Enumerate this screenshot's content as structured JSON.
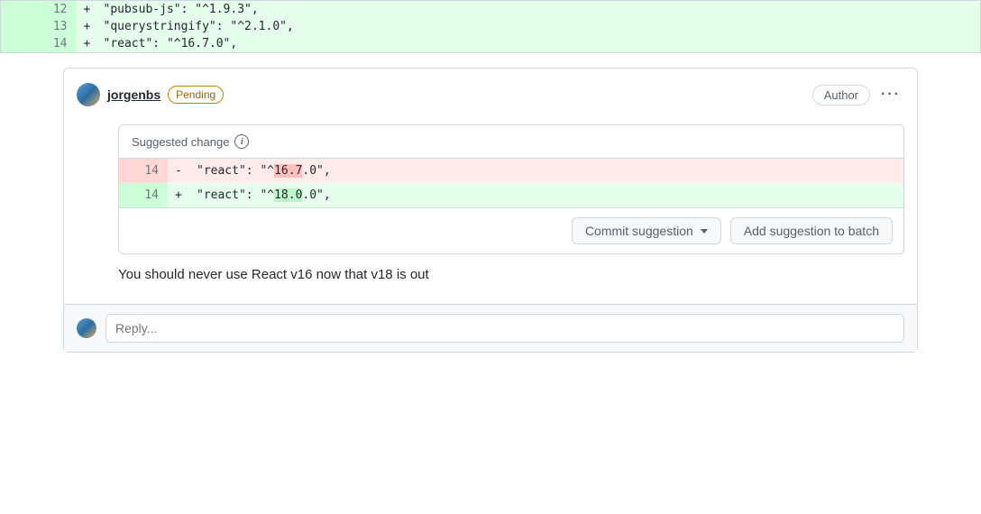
{
  "diff": {
    "lines": [
      {
        "num": "12",
        "marker": "+",
        "code": "\"pubsub-js\": \"^1.9.3\","
      },
      {
        "num": "13",
        "marker": "+",
        "code": "\"querystringify\": \"^2.1.0\","
      },
      {
        "num": "14",
        "marker": "+",
        "code": "\"react\": \"^16.7.0\","
      }
    ]
  },
  "comment": {
    "username": "jorgenbs",
    "pending_label": "Pending",
    "author_label": "Author",
    "text": "You should never use React v16 now that v18 is out"
  },
  "suggestion": {
    "header": "Suggested change",
    "del": {
      "num": "14",
      "marker": "-",
      "prefix": "\"react\": \"^",
      "hl": "16.7",
      "suffix": ".0\","
    },
    "add": {
      "num": "14",
      "marker": "+",
      "prefix": "\"react\": \"^",
      "hl": "18.0",
      "suffix": ".0\","
    },
    "commit_label": "Commit suggestion",
    "batch_label": "Add suggestion to batch"
  },
  "reply": {
    "placeholder": "Reply..."
  }
}
